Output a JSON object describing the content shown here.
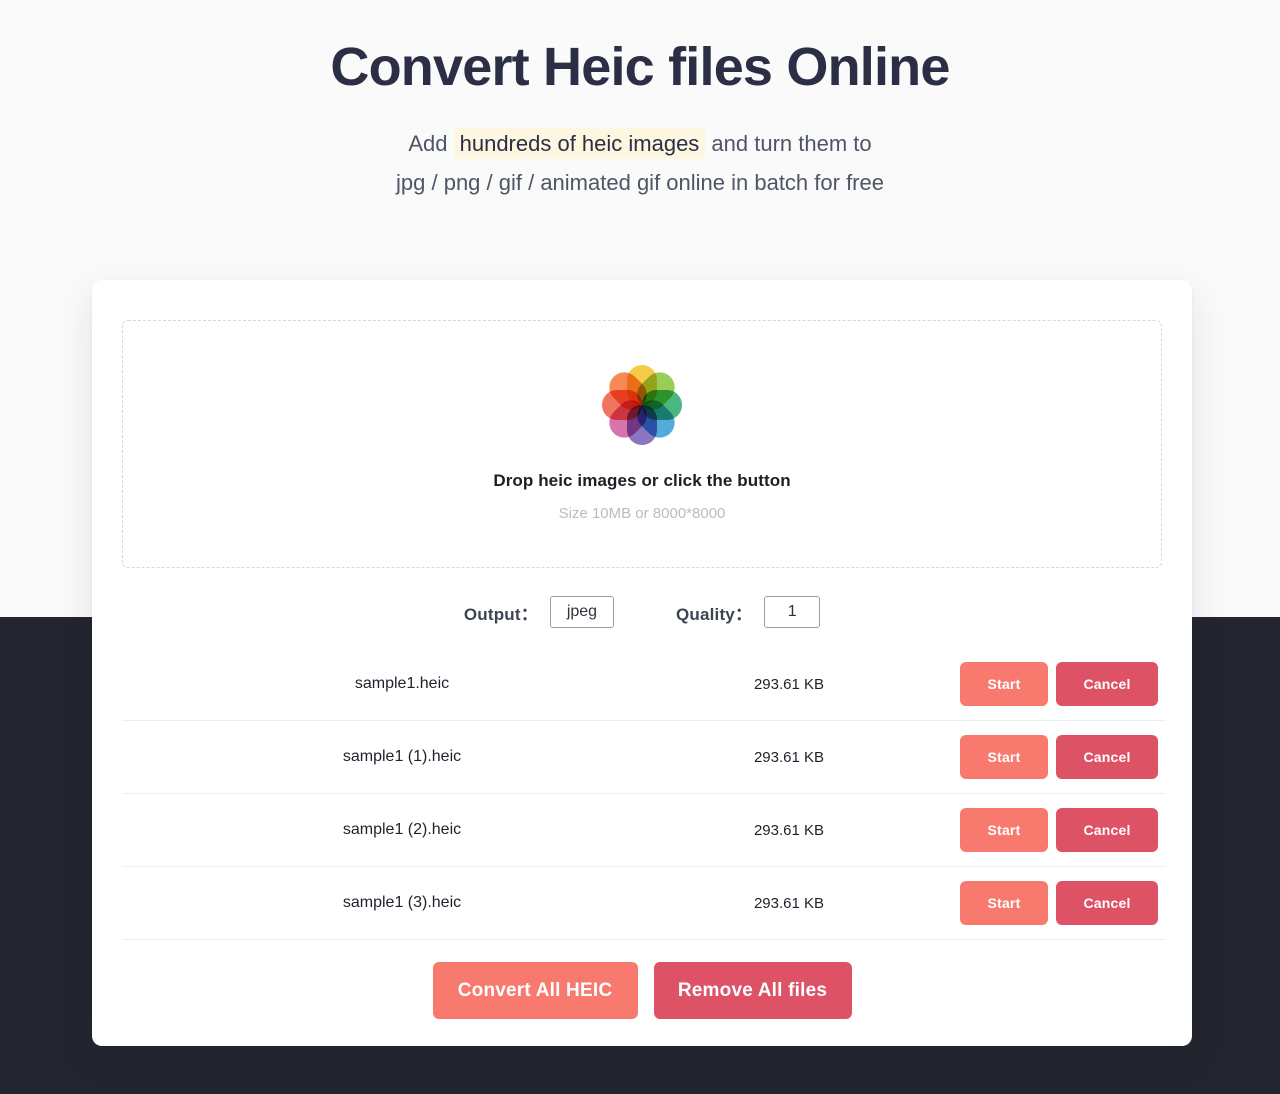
{
  "page": {
    "title": "Convert Heic files Online",
    "subtitle_before": "Add ",
    "subtitle_highlight": "hundreds of heic images",
    "subtitle_after": " and turn them to",
    "subtitle_line2": "jpg / png / gif / animated gif online in batch for free"
  },
  "colors": {
    "title": "#2b2e44",
    "highlight_bg": "#fdf6e0",
    "page_bg_top": "#fafafb",
    "page_bg_bottom": "#23252f",
    "card_bg": "#ffffff",
    "accent_start": "#f8796e",
    "accent_cancel": "#de5266",
    "dropzone_border": "#d6d8dd",
    "row_divider": "#eceef1"
  },
  "dropzone": {
    "icon": "apple-photos-flower-icon",
    "title": "Drop heic images or click the button",
    "hint": "Size 10MB or 8000*8000",
    "petals": [
      {
        "color": "#ef5f4c",
        "rotate": -90
      },
      {
        "color": "#f47a3c",
        "rotate": -45
      },
      {
        "color": "#f2c52f",
        "rotate": 0
      },
      {
        "color": "#8cc63e",
        "rotate": 45
      },
      {
        "color": "#2fae6e",
        "rotate": 90
      },
      {
        "color": "#3a9fd6",
        "rotate": 135
      },
      {
        "color": "#7764b8",
        "rotate": 180
      },
      {
        "color": "#d35fa0",
        "rotate": 225
      }
    ]
  },
  "options": {
    "output_label": "Output：",
    "output_value": "jpeg",
    "output_options": [
      "jpeg"
    ],
    "quality_label": "Quality：",
    "quality_value": "1"
  },
  "files": {
    "start_label": "Start",
    "cancel_label": "Cancel",
    "rows": [
      {
        "name": "sample1.heic",
        "size": "293.61 KB"
      },
      {
        "name": "sample1 (1).heic",
        "size": "293.61 KB"
      },
      {
        "name": "sample1 (2).heic",
        "size": "293.61 KB"
      },
      {
        "name": "sample1 (3).heic",
        "size": "293.61 KB"
      }
    ]
  },
  "footer": {
    "convert_all_label": "Convert All HEIC",
    "remove_all_label": "Remove All files"
  }
}
